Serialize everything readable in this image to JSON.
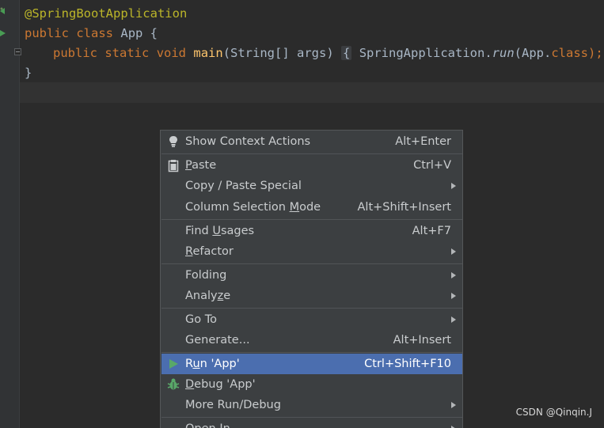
{
  "editor": {
    "lines": {
      "annotation": "@SpringBootApplication",
      "class_kw1": "public",
      "class_kw2": "class",
      "class_name": "App {",
      "main_kw1": "public",
      "main_kw2": "static",
      "main_kw3": "void",
      "main_name": "main",
      "main_params": "(String[] args)",
      "main_open": "{",
      "main_body_a": " SpringApplication.",
      "main_body_run": "run",
      "main_body_b": "(App.",
      "main_body_class_kw": "class",
      "main_body_c": ");",
      "main_close": "}",
      "closing": "}"
    }
  },
  "context_menu": {
    "items": [
      {
        "label": "Show Context Actions",
        "shortcut": "Alt+Enter",
        "icon": "lightbulb-icon"
      },
      {
        "label": "Paste",
        "mnemonic_pre": "",
        "mnemonic": "P",
        "mnemonic_post": "aste",
        "shortcut": "Ctrl+V",
        "icon": "clipboard-icon"
      },
      {
        "label": "Copy / Paste Special",
        "submenu": true
      },
      {
        "label_pre": "Column Selection ",
        "mnemonic": "M",
        "label_post": "ode",
        "shortcut": "Alt+Shift+Insert"
      },
      {
        "label_pre": "Find ",
        "mnemonic": "U",
        "label_post": "sages",
        "shortcut": "Alt+F7"
      },
      {
        "label_pre": "",
        "mnemonic": "R",
        "label_post": "efactor",
        "submenu": true
      },
      {
        "label": "Folding",
        "submenu": true
      },
      {
        "label_pre": "Analy",
        "mnemonic": "z",
        "label_post": "e",
        "submenu": true
      },
      {
        "label": "Go To",
        "submenu": true
      },
      {
        "label": "Generate...",
        "shortcut": "Alt+Insert"
      },
      {
        "label_pre": "R",
        "mnemonic": "u",
        "label_post": "n 'App'",
        "shortcut": "Ctrl+Shift+F10",
        "icon": "run-icon",
        "highlighted": true
      },
      {
        "label_pre": "",
        "mnemonic": "D",
        "label_post": "ebug 'App'",
        "icon": "debug-bug-icon"
      },
      {
        "label": "More Run/Debug",
        "submenu": true
      },
      {
        "label": "Open In",
        "submenu": true
      }
    ]
  },
  "watermark": "CSDN @Qinqin.J",
  "colors": {
    "editor_bg": "#2b2b2b",
    "menu_bg": "#3c3f41",
    "highlight": "#4b6eaf",
    "annotation": "#bbb529",
    "keyword": "#cc7832",
    "method": "#ffc66d",
    "run_green": "#499c54"
  }
}
